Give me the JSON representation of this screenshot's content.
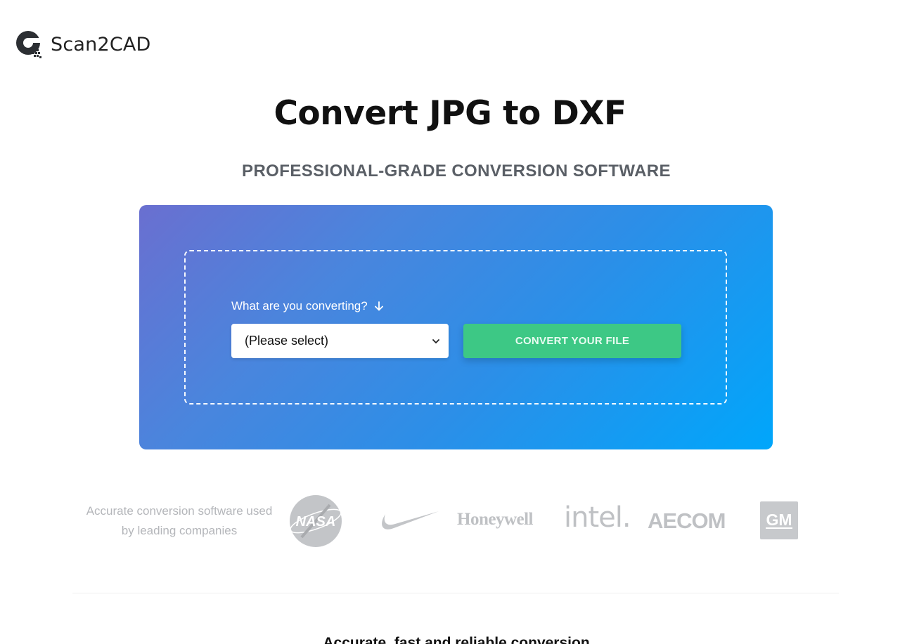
{
  "brand": {
    "name": "Scan2CAD",
    "logo_icon": "scan2cad-logo-icon"
  },
  "hero": {
    "title": "Convert JPG to DXF",
    "subtitle": "PROFESSIONAL-GRADE CONVERSION SOFTWARE"
  },
  "converter": {
    "prompt": "What are you converting?",
    "prompt_icon": "arrow-down-icon",
    "select_value": "(Please select)",
    "convert_label": "CONVERT YOUR FILE",
    "colors": {
      "gradient_start": "#6a6fd0",
      "gradient_end": "#00a6fb",
      "button": "#3dc885"
    }
  },
  "trust": {
    "text": "Accurate conversion software used by leading companies",
    "logos": {
      "nasa": "NASA",
      "nike": "nike-swoosh-logo",
      "honeywell": "Honeywell",
      "intel": "intel.",
      "aecom": "AECOM",
      "gm": "GM"
    }
  },
  "next_section": {
    "title": "Accurate, fast and reliable conversion"
  }
}
